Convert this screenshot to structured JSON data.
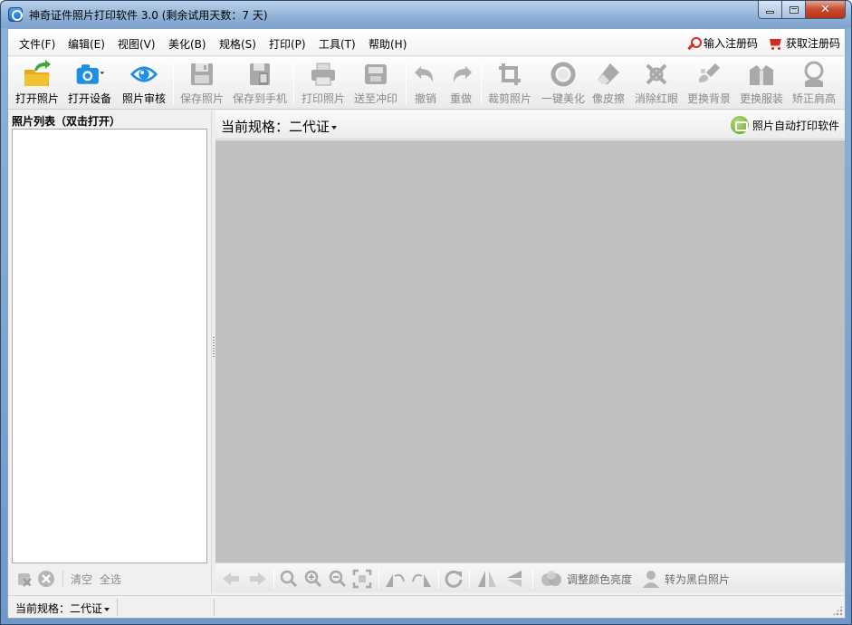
{
  "window": {
    "title": "神奇证件照片打印软件 3.0 (剩余试用天数：7 天)"
  },
  "menu": {
    "items": [
      "文件(F)",
      "编辑(E)",
      "视图(V)",
      "美化(B)",
      "规格(S)",
      "打印(P)",
      "工具(T)",
      "帮助(H)"
    ],
    "enter_code": "输入注册码",
    "get_code": "获取注册码"
  },
  "toolbar": {
    "items": [
      {
        "label": "打开照片",
        "icon": "folder-open-icon",
        "enabled": true
      },
      {
        "label": "打开设备",
        "icon": "camera-icon",
        "enabled": true
      },
      {
        "label": "照片审核",
        "icon": "eye-icon",
        "enabled": true
      },
      {
        "label": "保存照片",
        "icon": "floppy-icon",
        "enabled": false
      },
      {
        "label": "保存到手机",
        "icon": "phone-save-icon",
        "enabled": false
      },
      {
        "label": "打印照片",
        "icon": "printer-icon",
        "enabled": false
      },
      {
        "label": "送至冲印",
        "icon": "photo-print-icon",
        "enabled": false
      },
      {
        "label": "撤销",
        "icon": "undo-icon",
        "enabled": false
      },
      {
        "label": "重做",
        "icon": "redo-icon",
        "enabled": false
      },
      {
        "label": "裁剪照片",
        "icon": "crop-icon",
        "enabled": false
      },
      {
        "label": "一键美化",
        "icon": "beautify-icon",
        "enabled": false
      },
      {
        "label": "像皮擦",
        "icon": "eraser-icon",
        "enabled": false
      },
      {
        "label": "消除红眼",
        "icon": "redeye-icon",
        "enabled": false
      },
      {
        "label": "更换背景",
        "icon": "background-icon",
        "enabled": false
      },
      {
        "label": "更换服装",
        "icon": "clothes-icon",
        "enabled": false
      },
      {
        "label": "矫正肩高",
        "icon": "shoulder-icon",
        "enabled": false
      }
    ]
  },
  "left_panel": {
    "header": "照片列表（双击打开）",
    "clear": "清空",
    "select_all": "全选"
  },
  "right_panel": {
    "spec_prefix": "当前规格：",
    "spec_value": "二代证",
    "auto_print": "照片自动打印软件"
  },
  "image_tools": {
    "adjust_label": "调整颜色亮度",
    "bw_label": "转为黑白照片"
  },
  "statusbar": {
    "spec_text": "当前规格：二代证"
  },
  "colors": {
    "accent_blue": "#1f8fe0",
    "disabled_gray": "#a0a0a0",
    "canvas_gray": "#c0c0c0",
    "register_red": "#d42c1e",
    "folder_yellow": "#f2c230",
    "arrow_green": "#3fa83a"
  }
}
